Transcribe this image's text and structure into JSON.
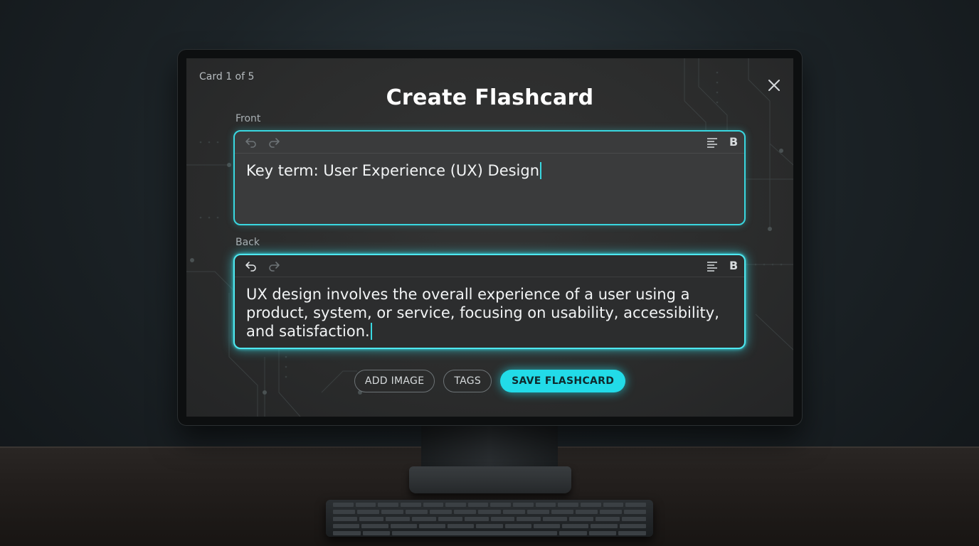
{
  "header": {
    "card_counter": "Card 1 of 5",
    "title": "Create Flashcard"
  },
  "front": {
    "label": "Front",
    "text": "Key term: User Experience (UX) Design",
    "bold_label": "B"
  },
  "back": {
    "label": "Back",
    "text": "UX design involves the overall experience of a user using a product, system, or service, focusing on usability, accessibility, and satisfaction.",
    "bold_label": "B"
  },
  "actions": {
    "add_image": "ADD IMAGE",
    "tags": "TAGS",
    "save": "SAVE FLASHCARD"
  },
  "icons": {
    "close": "close-icon",
    "undo": "undo-icon",
    "redo": "redo-icon",
    "align": "align-left-icon"
  },
  "colors": {
    "accent": "#22dbe8",
    "background": "#2b2c2c",
    "text": "#ffffff"
  }
}
